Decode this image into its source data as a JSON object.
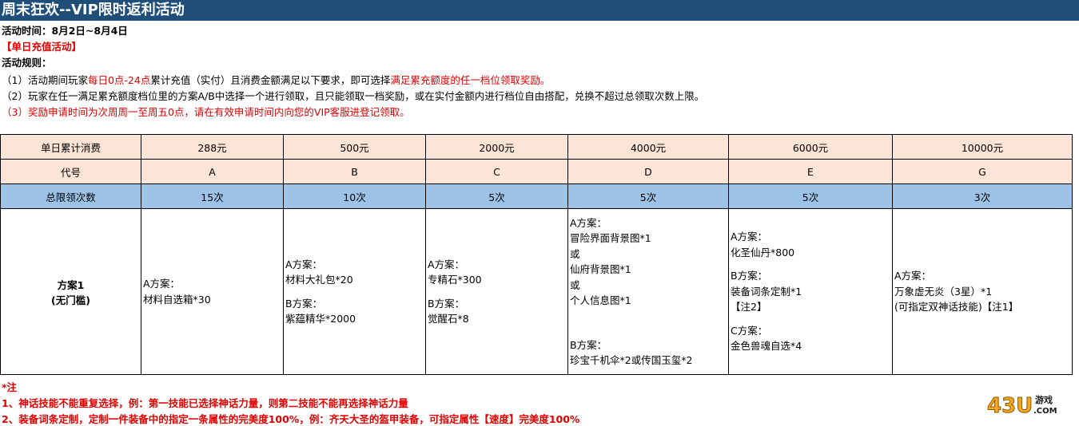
{
  "title": "周末狂欢--VIP限时返利活动",
  "time_label": "活动时间：8月2日~8月4日",
  "section": "【单日充值活动】",
  "rules_label": "活动规则：",
  "rule1_a": "（1）活动期间玩家",
  "rule1_b": "每日0点-24点",
  "rule1_c": "累计充值（实付）且消费金额满足以下要求，即可选择",
  "rule1_d": "满足累充额度的任一档位领取奖励。",
  "rule2": "（2）玩家在任一满足累充额度档位里的方案A/B中选择一个进行领取，且只能领取一档奖励，或在实付金额内进行档位自由搭配，兑换不超过总领取次数上限。",
  "rule3": "（3）奖励申请时间为次周周一至周五0点，请在有效申请时间内向您的VIP客服进登记领取。",
  "table": {
    "row_spend_label": "单日累计消费",
    "spend": [
      "288元",
      "500元",
      "2000元",
      "4000元",
      "6000元",
      "10000元"
    ],
    "row_code_label": "代号",
    "codes": [
      "A",
      "B",
      "C",
      "D",
      "E",
      "G"
    ],
    "row_limit_label": "总限领次数",
    "limits": [
      "15次",
      "10次",
      "5次",
      "5次",
      "5次",
      "3次"
    ],
    "plan_label": "方案1",
    "plan_sub": "(无门槛)",
    "tier_a": [
      "A方案：",
      "材料自选箱*30"
    ],
    "tier_b": {
      "a": [
        "A方案：",
        "材料大礼包*20"
      ],
      "b": [
        "B方案：",
        "紫蕴精华*2000"
      ]
    },
    "tier_c": {
      "a": [
        "A方案：",
        "专精石*300"
      ],
      "b": [
        "B方案：",
        "觉醒石*8"
      ]
    },
    "tier_d": {
      "a": [
        "A方案：",
        "冒险界面背景图*1",
        "或",
        "仙府背景图*1",
        "或",
        "个人信息图*1"
      ],
      "b": [
        "B方案：",
        "珍宝千机伞*2或传国玉玺*2"
      ]
    },
    "tier_e": {
      "a": [
        "A方案：",
        "化圣仙丹*800"
      ],
      "b": [
        "B方案：",
        "装备词条定制*1",
        "【注2】"
      ],
      "c": [
        "C方案：",
        "金色兽魂自选*4"
      ]
    },
    "tier_g": [
      "A方案：",
      "万象虚无炎（3星）*1",
      "(可指定双神话技能)【注1】"
    ]
  },
  "notes": {
    "head": "*注",
    "n1": "1、神话技能不能重复选择，例：第一技能已选择神话力量，则第二技能不能再选择神话力量",
    "n2": "2、装备词条定制，定制一件装备中的指定一条属性的完美度100%，例：齐天大圣的盔甲装备，可指定属性【速度】完美度100%"
  },
  "logo": {
    "num": "43U",
    "cn": "游戏",
    "dom": ".COM",
    "color": "#f5a623"
  }
}
